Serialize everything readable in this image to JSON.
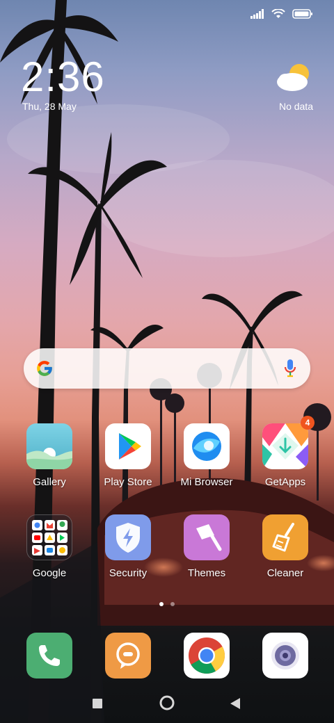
{
  "status_bar": {
    "signal_icon": "signal-icon",
    "wifi_icon": "wifi-icon",
    "battery_icon": "battery-icon"
  },
  "clock": {
    "time": "2:36",
    "date": "Thu, 28 May"
  },
  "weather": {
    "icon": "partly-cloudy-icon",
    "text": "No data"
  },
  "search_bar": {
    "logo": "google-g-icon",
    "mic": "mic-icon"
  },
  "apps": {
    "gallery": {
      "label": "Gallery"
    },
    "play_store": {
      "label": "Play Store"
    },
    "mi_browser": {
      "label": "Mi Browser"
    },
    "getapps": {
      "label": "GetApps",
      "badge": "4"
    },
    "google": {
      "label": "Google"
    },
    "security": {
      "label": "Security"
    },
    "themes": {
      "label": "Themes"
    },
    "cleaner": {
      "label": "Cleaner"
    }
  },
  "page_indicator": {
    "pages": 2,
    "active": 1
  },
  "dock": [
    "phone-icon",
    "messaging-icon",
    "chrome-icon",
    "camera-icon"
  ],
  "nav_bar": [
    "recents-button",
    "home-button",
    "back-button"
  ],
  "colors": {
    "phone": "#4cae72",
    "messaging": "#ef9a45",
    "security": "#6f8fe6",
    "themes": "#c46ad0",
    "cleaner": "#f09a2a",
    "badge": "#f0541f"
  }
}
